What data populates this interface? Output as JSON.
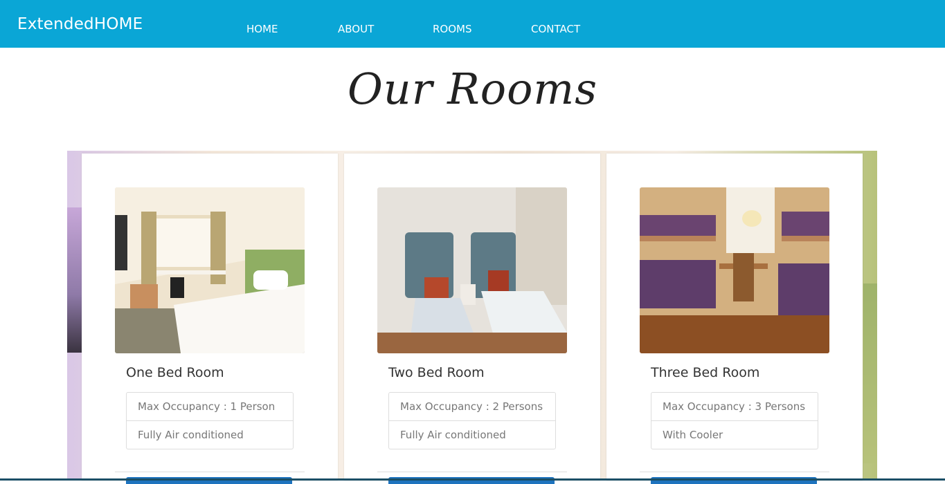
{
  "navbar": {
    "brand": "ExtendedHOME",
    "links": [
      "HOME",
      "ABOUT",
      "ROOMS",
      "CONTACT"
    ]
  },
  "page": {
    "title": "Our Rooms"
  },
  "rooms": [
    {
      "title": "One Bed Room",
      "details": [
        "Max Occupancy : 1 Person",
        "Fully Air conditioned"
      ]
    },
    {
      "title": "Two Bed Room",
      "details": [
        "Max Occupancy : 2 Persons",
        "Fully Air conditioned"
      ]
    },
    {
      "title": "Three Bed Room",
      "details": [
        "Max Occupancy : 3 Persons",
        "With Cooler"
      ]
    }
  ],
  "colors": {
    "navbar": "#0aa6d6",
    "button": "#1e73be"
  }
}
